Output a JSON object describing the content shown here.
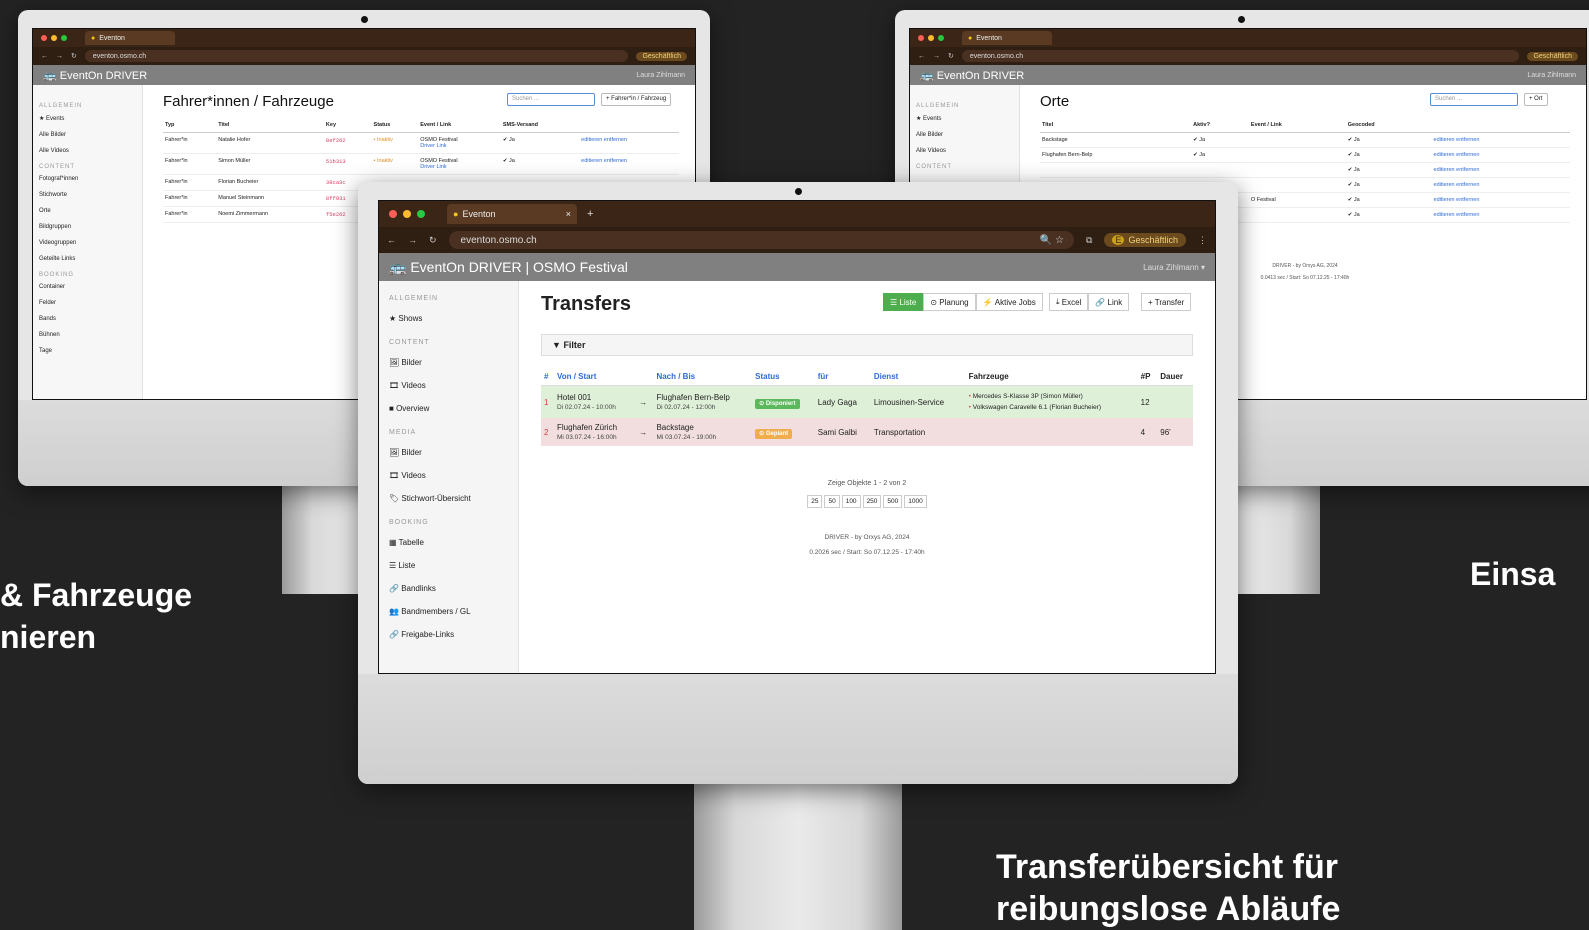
{
  "captions": {
    "left_line1": "& Fahrzeuge",
    "left_line2": "nieren",
    "right": "Einsa",
    "bottom_line1": "Transferübersicht für",
    "bottom_line2": "reibungslose Abläufe"
  },
  "browser": {
    "tab_title": "Eventon",
    "url": "eventon.osmo.ch",
    "profile": "Geschäftlich",
    "profile_initial": "E"
  },
  "left_screen": {
    "app_title": "EventOn DRIVER",
    "user": "Laura Zihlmann",
    "page_title": "Fahrer*innen / Fahrzeuge",
    "search_placeholder": "Suchen ...",
    "add_button": "+ Fahrer*in / Fahrzeug",
    "sidebar": {
      "sec1": "ALLGEMEIN",
      "sec1_items": [
        "★ Events",
        "Alle Bilder",
        "Alle Videos"
      ],
      "sec2": "CONTENT",
      "sec2_items": [
        "Fotograf*innen",
        "Stichworte",
        "Orte",
        "Bildgruppen",
        "Videogruppen",
        "Geteilte Links"
      ],
      "sec3": "BOOKING",
      "sec3_items": [
        "Container",
        "Felder",
        "Bands",
        "Bühnen",
        "Tage"
      ]
    },
    "columns": [
      "Typ",
      "Titel",
      "Key",
      "Status",
      "Event / Link",
      "SMS-Versand"
    ],
    "rows": [
      {
        "typ": "Fahrer*in",
        "titel": "Natalie Hofer",
        "key": "8ef262",
        "status": "• Inaktiv",
        "event": "OSMO Festival",
        "link": "Driver Link",
        "sms": "✔ Ja"
      },
      {
        "typ": "Fahrer*in",
        "titel": "Simon Müller",
        "key": "51b313",
        "status": "• Inaktiv",
        "event": "OSMO Festival",
        "link": "Driver Link",
        "sms": "✔ Ja"
      },
      {
        "typ": "Fahrer*in",
        "titel": "Florian Bucheier",
        "key": "38ca3c",
        "status": "",
        "event": "",
        "link": "",
        "sms": ""
      },
      {
        "typ": "Fahrer*in",
        "titel": "Manuel Steinmann",
        "key": "8ff931",
        "status": "",
        "event": "",
        "link": "",
        "sms": ""
      },
      {
        "typ": "Fahrer*in",
        "titel": "Noemi Zimmermann",
        "key": "f5e262",
        "status": "",
        "event": "",
        "link": "",
        "sms": ""
      }
    ],
    "row_actions": "editieren  entfernen"
  },
  "right_screen": {
    "app_title": "EventOn DRIVER",
    "user": "Laura Zihlmann",
    "page_title": "Orte",
    "search_placeholder": "Suchen ...",
    "add_button": "+ Ort",
    "sidebar": {
      "sec1": "ALLGEMEIN",
      "sec1_items": [
        "★ Events",
        "Alle Bilder",
        "Alle Videos"
      ],
      "sec2": "CONTENT"
    },
    "columns": [
      "Titel",
      "Aktiv?",
      "Event / Link",
      "Geocoded"
    ],
    "rows": [
      {
        "titel": "Backstage",
        "aktiv": "✔ Ja",
        "event": "",
        "geo": "✔ Ja"
      },
      {
        "titel": "Flughafen Bern-Belp",
        "aktiv": "✔ Ja",
        "event": "",
        "geo": "✔ Ja"
      },
      {
        "titel": "",
        "aktiv": "",
        "event": "",
        "geo": "✔ Ja"
      },
      {
        "titel": "",
        "aktiv": "",
        "event": "",
        "geo": "✔ Ja"
      },
      {
        "titel": "",
        "aktiv": "",
        "event": "O Festival",
        "geo": "✔ Ja"
      },
      {
        "titel": "",
        "aktiv": "",
        "event": "",
        "geo": "✔ Ja"
      }
    ],
    "row_actions": "editieren  entfernen",
    "footer1": "DRIVER - by Orxys AG, 2024",
    "footer2": "0.0413 sec / Start: So 07.12.25 - 17:40h"
  },
  "front_screen": {
    "app_title": "EventOn DRIVER | OSMO Festival",
    "user": "Laura Zihlmann",
    "page_title": "Transfers",
    "buttons": [
      "Liste",
      "Planung",
      "Aktive Jobs"
    ],
    "buttons2": [
      "Excel",
      "Link"
    ],
    "add_button": "+ Transfer",
    "filter": "Filter",
    "sidebar": {
      "sec1": "ALLGEMEIN",
      "sec1_items": [
        "★ Shows"
      ],
      "sec2": "CONTENT",
      "sec2_items": [
        "Bilder",
        "Videos",
        "Overview"
      ],
      "sec3": "MEDIA",
      "sec3_items": [
        "Bilder",
        "Videos",
        "Stichwort-Übersicht"
      ],
      "sec4": "BOOKING",
      "sec4_items": [
        "Tabelle",
        "Liste",
        "Bandlinks",
        "Bandmembers / GL",
        "Freigabe-Links"
      ]
    },
    "columns": [
      "#",
      "Von / Start",
      "Nach / Bis",
      "Status",
      "für",
      "Dienst",
      "Fahrzeuge",
      "#P",
      "Dauer"
    ],
    "rows": [
      {
        "n": "1",
        "von": "Hotel 001",
        "von_t": "Di 02.07.24 - 10:00h",
        "nach": "Flughafen Bern-Belp",
        "nach_t": "Di 02.07.24 - 12:00h",
        "status": "Disponiert",
        "fuer": "Lady Gaga",
        "dienst": "Limousinen-Service",
        "fz1": "Mercedes S-Klasse 3P (Simon Müller)",
        "fz2": "Volkswagen Caravelle 6.1 (Florian Bucheier)",
        "p": "12",
        "dauer": ""
      },
      {
        "n": "2",
        "von": "Flughafen Zürich",
        "von_t": "Mi 03.07.24 - 16:00h",
        "nach": "Backstage",
        "nach_t": "Mi 03.07.24 - 19:00h",
        "status": "Geplant",
        "fuer": "Sami Galbi",
        "dienst": "Transportation",
        "fz1": "",
        "fz2": "",
        "p": "4",
        "dauer": "96'"
      }
    ],
    "summary": "Zeige Objekte 1 - 2 von 2",
    "pager": [
      "25",
      "50",
      "100",
      "250",
      "500",
      "1000"
    ],
    "footer1": "DRIVER - by Orxys AG, 2024",
    "footer2": "0.2026 sec / Start: So 07.12.25 - 17:40h"
  },
  "colors": {
    "bg": "#232323",
    "chrome": "#3b2516",
    "appbar": "#808080",
    "green_row": "#dff0d8",
    "red_row": "#f2dede",
    "link": "#2f6bd6"
  }
}
